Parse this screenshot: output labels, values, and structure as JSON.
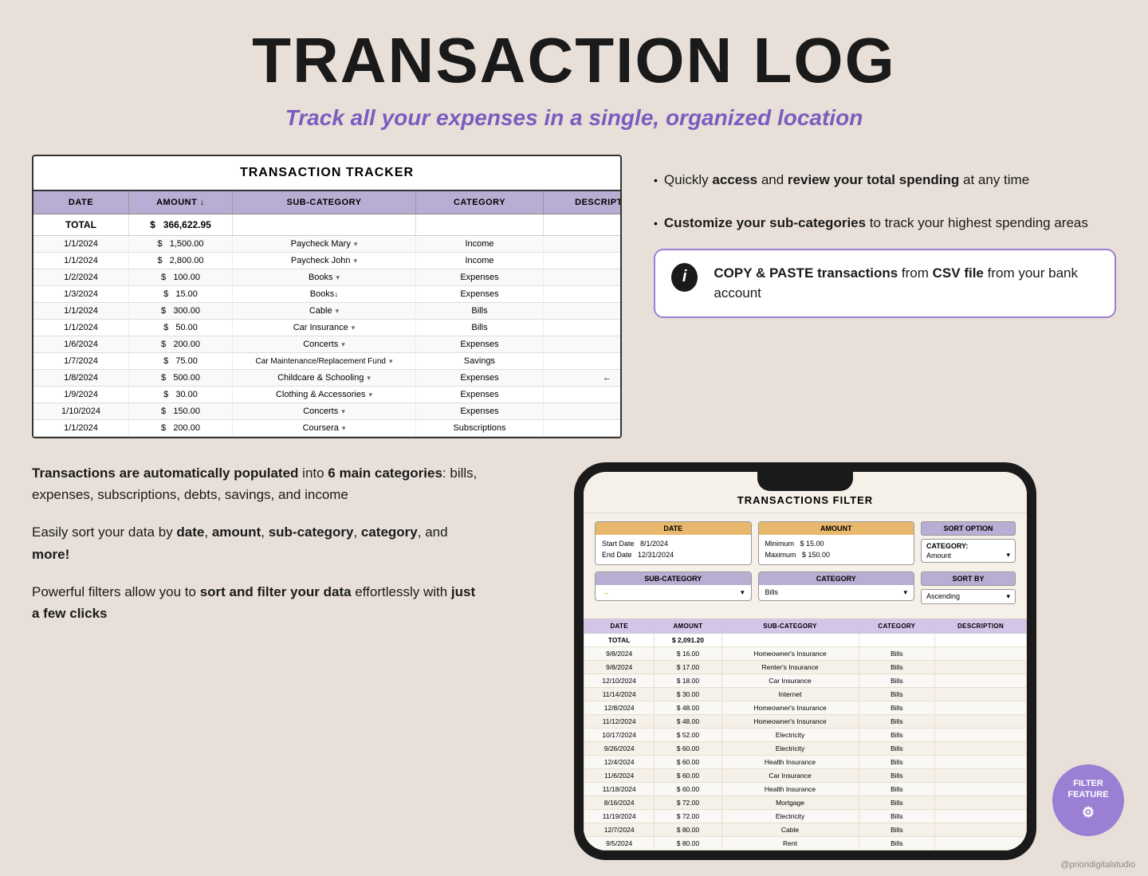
{
  "page": {
    "title": "TRANSACTION LOG",
    "subtitle": "Track all your expenses in a single, organized location",
    "bg_color": "#e8e0d8"
  },
  "tracker": {
    "title": "TRANSACTION TRACKER",
    "headers": [
      "DATE",
      "AMOUNT ↓",
      "SUB-CATEGORY",
      "CATEGORY",
      "DESCRIPTION"
    ],
    "total_row": [
      "TOTAL",
      "$",
      "366,622.95",
      "",
      ""
    ],
    "rows": [
      [
        "1/1/2024",
        "$",
        "1,500.00",
        "Paycheck Mary",
        "Income",
        ""
      ],
      [
        "1/1/2024",
        "$",
        "2,800.00",
        "Paycheck John",
        "Income",
        ""
      ],
      [
        "1/2/2024",
        "$",
        "100.00",
        "Books",
        "Expenses",
        ""
      ],
      [
        "1/3/2024",
        "$",
        "15.00",
        "Books",
        "Expenses",
        ""
      ],
      [
        "1/1/2024",
        "$",
        "300.00",
        "Cable",
        "Bills",
        ""
      ],
      [
        "1/1/2024",
        "$",
        "50.00",
        "Car Insurance",
        "Bills",
        ""
      ],
      [
        "1/6/2024",
        "$",
        "200.00",
        "Concerts",
        "Expenses",
        ""
      ],
      [
        "1/7/2024",
        "$",
        "75.00",
        "Car Maintenance/Replacement Fund",
        "Savings",
        ""
      ],
      [
        "1/8/2024",
        "$",
        "500.00",
        "Childcare & Schooling",
        "Expenses",
        ""
      ],
      [
        "1/9/2024",
        "$",
        "30.00",
        "Clothing & Accessories",
        "Expenses",
        ""
      ],
      [
        "1/10/2024",
        "$",
        "150.00",
        "Concerts",
        "Expenses",
        ""
      ],
      [
        "1/1/2024",
        "$",
        "200.00",
        "Coursera",
        "Subscriptions",
        ""
      ]
    ]
  },
  "annotations": {
    "access_review": "Quickly access and review your total spending at any time",
    "customize": "Customize your sub-categories to track your highest spending areas",
    "copy_paste_title": "COPY & PASTE transactions from CSV file from your bank account",
    "auto_populate": "Transactions are automatically populated into 6 main categories: bills, expenses, subscriptions, debts, savings, and income",
    "sort_text": "Easily sort your data by date, amount, sub-category, category, and more!",
    "filter_text": "Powerful filters allow you to sort and filter your data effortlessly with just a few clicks"
  },
  "filter_screen": {
    "title": "TRANSACTIONS FILTER",
    "date_label": "DATE",
    "start_date": "8/1/2024",
    "end_date": "12/31/2024",
    "amount_label": "AMOUNT",
    "minimum": "$ 15.00",
    "maximum": "$ 150.00",
    "sort_option_label": "SORT OPTION",
    "category_label": "CATEGORY:",
    "category_value": "Amount",
    "subcategory_label": "SUB-CATEGORY",
    "category2_label": "CATEGORY",
    "category2_value": "Bills",
    "sort_by_label": "SORT BY",
    "sort_by_value": "Ascending",
    "table_headers": [
      "DATE",
      "AMOUNT",
      "SUB-CATEGORY",
      "CATEGORY",
      "DESCRIPTION"
    ],
    "total_label": "TOTAL",
    "total_value": "$ 2,091.20",
    "table_rows": [
      [
        "9/8/2024",
        "$",
        "16.00",
        "Homeowner's Insurance",
        "Bills",
        ""
      ],
      [
        "9/8/2024",
        "$",
        "17.00",
        "Renter's Insurance",
        "Bills",
        ""
      ],
      [
        "12/10/2024",
        "$",
        "18.00",
        "Car Insurance",
        "Bills",
        ""
      ],
      [
        "11/14/2024",
        "$",
        "30.00",
        "Internet",
        "Bills",
        ""
      ],
      [
        "12/8/2024",
        "$",
        "48.00",
        "Homeowner's Insurance",
        "Bills",
        ""
      ],
      [
        "11/12/2024",
        "$",
        "48.00",
        "Homeowner's Insurance",
        "Bills",
        ""
      ],
      [
        "10/17/2024",
        "$",
        "52.00",
        "Electricity",
        "Bills",
        ""
      ],
      [
        "9/26/2024",
        "$",
        "60.00",
        "Electricity",
        "Bills",
        ""
      ],
      [
        "12/4/2024",
        "$",
        "60.00",
        "Health Insurance",
        "Bills",
        ""
      ],
      [
        "11/6/2024",
        "$",
        "60.00",
        "Car Insurance",
        "Bills",
        ""
      ],
      [
        "11/18/2024",
        "$",
        "60.00",
        "Health Insurance",
        "Bills",
        ""
      ],
      [
        "8/16/2024",
        "$",
        "72.00",
        "Mortgage",
        "Bills",
        ""
      ],
      [
        "11/19/2024",
        "$",
        "72.00",
        "Electricity",
        "Bills",
        ""
      ],
      [
        "12/7/2024",
        "$",
        "80.00",
        "Cable",
        "Bills",
        ""
      ],
      [
        "9/5/2024",
        "$",
        "80.00",
        "Rent",
        "Bills",
        ""
      ]
    ]
  },
  "filter_feature_badge": "FILTER\nFEATURE",
  "watermark": "@prioridigitalstudio"
}
